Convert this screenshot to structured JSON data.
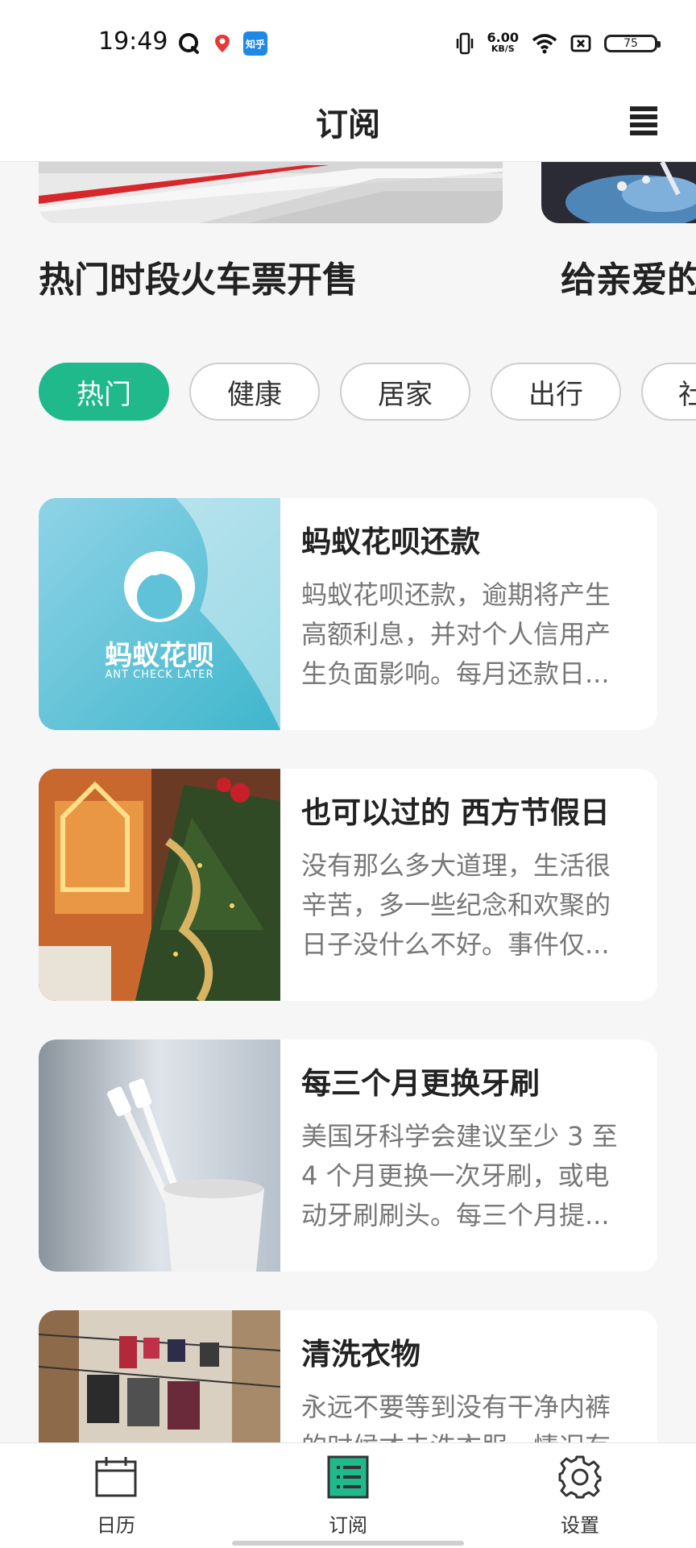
{
  "status_bar": {
    "time": "19:49",
    "net_speed_value": "6.00",
    "net_speed_unit": "KB/S",
    "battery": "75",
    "app_icons": [
      "qq-icon",
      "location-pin-icon",
      "zhihu-icon"
    ],
    "zhihu_text": "知乎",
    "indicators": [
      "vibrate-icon",
      "wifi-icon",
      "sim-off-icon"
    ]
  },
  "header": {
    "title": "订阅",
    "menu_icon": "list-menu-icon"
  },
  "banners": [
    {
      "title": "热门时段火车票开售"
    },
    {
      "title": "给亲爱的"
    }
  ],
  "categories": [
    {
      "label": "热门",
      "active": true
    },
    {
      "label": "健康",
      "active": false
    },
    {
      "label": "居家",
      "active": false
    },
    {
      "label": "出行",
      "active": false
    },
    {
      "label": "社",
      "active": false
    }
  ],
  "articles": [
    {
      "title": "蚂蚁花呗还款",
      "desc": "蚂蚁花呗还款，逾期将产生高额利息，并对个人信用产生负面影响。每月还款日...",
      "thumb_text": "蚂蚁花呗",
      "thumb_subtext": "ANT CHECK LATER"
    },
    {
      "title": "也可以过的 西方节假日",
      "desc": "没有那么多大道理，生活很辛苦，多一些纪念和欢聚的日子没什么不好。事件仅..."
    },
    {
      "title": "每三个月更换牙刷",
      "desc": "美国牙科学会建议至少 3 至 4 个月更换一次牙刷，或电动牙刷刷头。每三个月提..."
    },
    {
      "title": "清洗衣物",
      "desc": "永远不要等到没有干净内裤的时候才去洗衣服，情况有"
    }
  ],
  "bottom_nav": [
    {
      "label": "日历",
      "icon": "calendar-icon",
      "active": false
    },
    {
      "label": "订阅",
      "icon": "subscription-icon",
      "active": true
    },
    {
      "label": "设置",
      "icon": "gear-icon",
      "active": false
    }
  ],
  "colors": {
    "accent": "#1fb98c",
    "background": "#f6f6f6"
  }
}
